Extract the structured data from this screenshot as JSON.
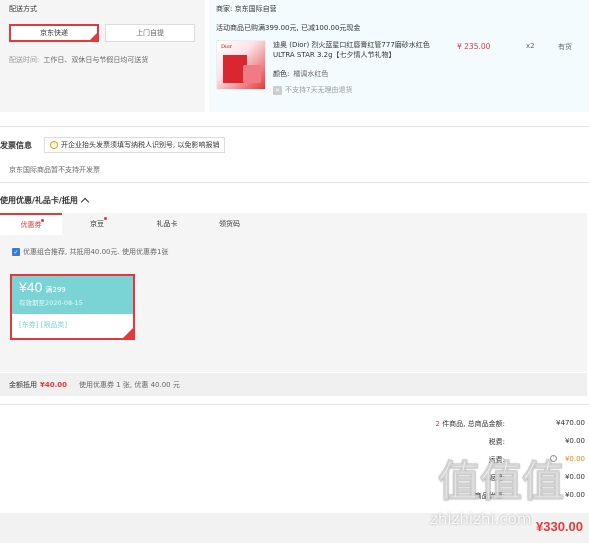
{
  "delivery": {
    "title": "配送方式",
    "options": [
      "京东快递",
      "上门自提"
    ],
    "selected": "京东快递",
    "time_label": "配送时间:",
    "time_value": "工作日、双休日与节假日均可送货"
  },
  "store": {
    "name": "商家: 京东国际自营",
    "promo": "活动商品已购满399.00元, 已减100.00元现金",
    "product": {
      "image_brand": "Dior",
      "title": "迪奥 (Dior) 烈火蓝星口红唇膏红管777磨砂水红色ULTRA STAR 3.2g【七夕情人节礼物】",
      "price": "¥ 235.00",
      "qty": "x2",
      "stock": "有货",
      "color_label": "颜色:",
      "color_value": "橘调水红色",
      "return_policy": "不支持7天无理由退货"
    }
  },
  "invoice": {
    "title": "发票信息",
    "tip": "开企业抬头发票须填写纳税人识别号, 以免影响报销",
    "note": "京东国际商品暂不支持开发票"
  },
  "coupons": {
    "title": "使用优惠/礼品卡/抵用",
    "tabs": [
      "优惠券",
      "京豆",
      "礼品卡",
      "领货码"
    ],
    "active_tab": "优惠券",
    "tab_dots": [
      true,
      true,
      false,
      false
    ],
    "combo_text": "优惠组合推荐, 共抵用40.00元. 使用优惠券1张",
    "combo_checked": true,
    "coupon": {
      "amount": "¥40",
      "condition": "满299",
      "expiry": "有效期至2020-08-15",
      "tags": "[东券]  [限品类]"
    },
    "discount_label": "金额抵用",
    "discount_value": "¥40.00",
    "used_text": "使用优惠券 1 张, 优惠 40.00 元"
  },
  "summary": {
    "items_count": "2",
    "items_label": "件商品, 总商品金额:",
    "items_value": "¥470.00",
    "tax_label": "税费:",
    "tax_value": "¥0.00",
    "shipping_label": "运费:",
    "shipping_value": "¥0.00",
    "row4_label": "返现:",
    "row4_value": "¥0.00",
    "row5_label": "商品优惠:",
    "row5_value": "¥0.00"
  },
  "footer": {
    "total": "¥330.00"
  },
  "watermark": {
    "chars": [
      "值",
      "值",
      "值"
    ],
    "site": "zhizhizhi.com"
  },
  "colors": {
    "accent": "#e4393c",
    "coupon_bg": "#7ad3d5",
    "store_bg": "#f3fbfe",
    "panel_bg": "#f5f5f5"
  }
}
